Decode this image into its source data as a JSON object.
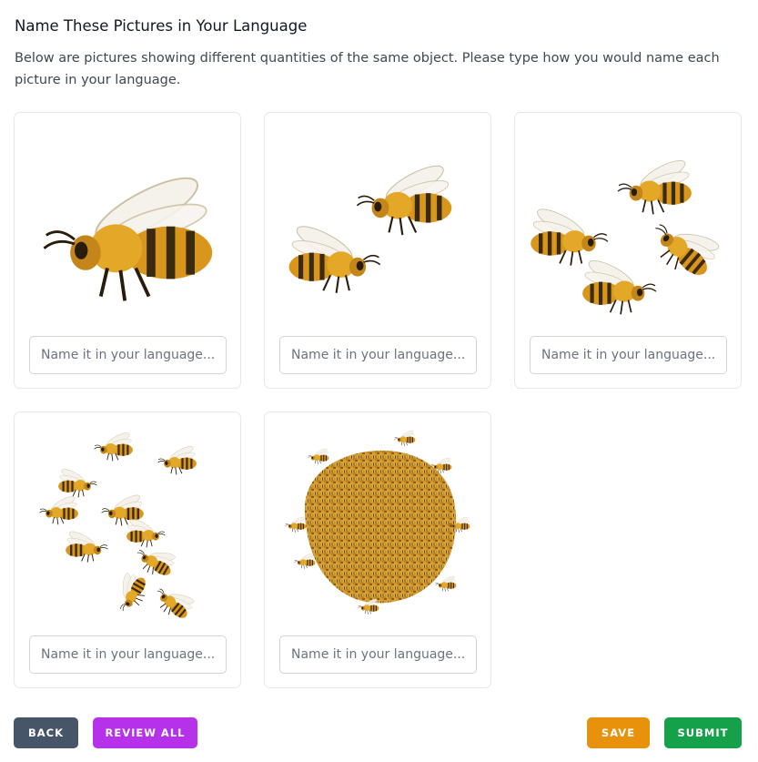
{
  "page": {
    "title": "Name These Pictures in Your Language",
    "description": "Below are pictures showing different quantities of the same object. Please type how you would name each picture in your language."
  },
  "cards": [
    {
      "image": "one-bee-picture",
      "count": 1,
      "placeholder": "Name it in your language..."
    },
    {
      "image": "two-bees-picture",
      "count": 2,
      "placeholder": "Name it in your language..."
    },
    {
      "image": "four-bees-picture",
      "count": 4,
      "placeholder": "Name it in your language..."
    },
    {
      "image": "eleven-bees-picture",
      "count": 11,
      "placeholder": "Name it in your language..."
    },
    {
      "image": "bee-swarm-picture",
      "count": "swarm",
      "placeholder": "Name it in your language..."
    }
  ],
  "buttons": {
    "back": "BACK",
    "review_all": "REVIEW ALL",
    "save": "SAVE",
    "submit": "SUBMIT"
  },
  "colors": {
    "back": "#475569",
    "review_all": "#b531ea",
    "save": "#e8910b",
    "submit": "#15a04a",
    "bee_body": "#e0a020",
    "bee_stripe": "#3a2a10"
  }
}
